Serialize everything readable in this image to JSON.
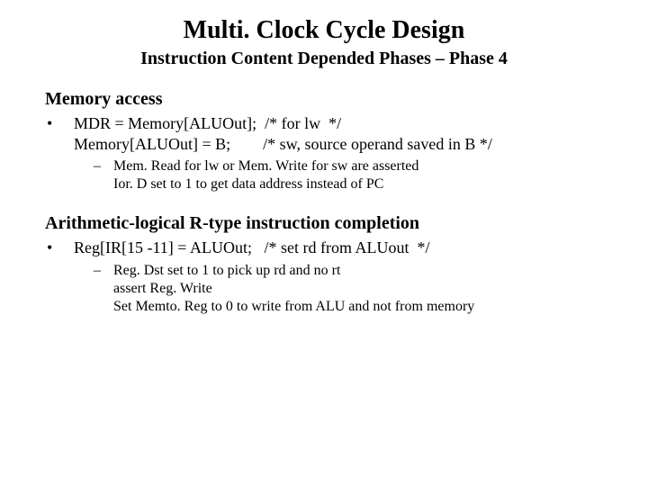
{
  "title": "Multi. Clock Cycle Design",
  "subtitle": "Instruction Content Depended Phases – Phase 4",
  "section1": {
    "heading": "Memory access",
    "bullet_dot": "•",
    "line1_stmt": "MDR = Memory[ALUOut];  ",
    "line1_cmt": "/* for lw  */",
    "line2_stmt": "Memory[ALUOut] = B;        ",
    "line2_cmt": "/* sw, source operand saved in B */",
    "sub_dash": "–",
    "sub_line1": "Mem. Read for lw or Mem. Write for sw are asserted",
    "sub_line2": "Ior. D set to 1 to get data address instead of PC"
  },
  "section2": {
    "heading": "Arithmetic-logical R-type instruction completion",
    "bullet_dot": "•",
    "line1_stmt": "Reg[IR[15 -11] = ALUOut;   ",
    "line1_cmt": "/* set rd from ALUout  */",
    "sub_dash": "–",
    "sub_line1": "Reg. Dst set to 1 to pick up rd and no rt",
    "sub_line2": "assert Reg. Write",
    "sub_line3": "Set Memto. Reg to 0 to write from ALU and not from memory"
  }
}
